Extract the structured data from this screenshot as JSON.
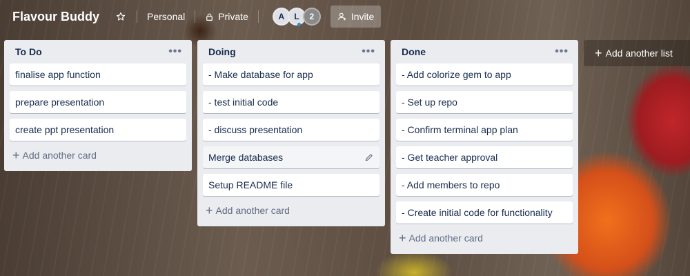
{
  "header": {
    "board_title": "Flavour Buddy",
    "star_icon": "star-icon",
    "team_label": "Personal",
    "visibility_label": "Private",
    "members": [
      {
        "initial": "A"
      },
      {
        "initial": "L"
      }
    ],
    "member_count": "2",
    "invite_label": "Invite"
  },
  "lists": [
    {
      "title": "To Do",
      "cards": [
        "finalise app function",
        "prepare presentation",
        "create ppt presentation"
      ],
      "add_card_label": "Add another card"
    },
    {
      "title": "Doing",
      "cards": [
        "- Make database for app",
        "- test initial code",
        "- discuss presentation",
        "Merge databases",
        "Setup README file"
      ],
      "add_card_label": "Add another card"
    },
    {
      "title": "Done",
      "cards": [
        "- Add colorize gem to app",
        "- Set up repo",
        "- Confirm terminal app plan",
        "- Get teacher approval",
        "- Add members to repo",
        "- Create initial code for functionality"
      ],
      "add_card_label": "Add another card"
    }
  ],
  "add_list_label": "Add another list",
  "list_menu_glyph": "•••",
  "plus_glyph": "+"
}
